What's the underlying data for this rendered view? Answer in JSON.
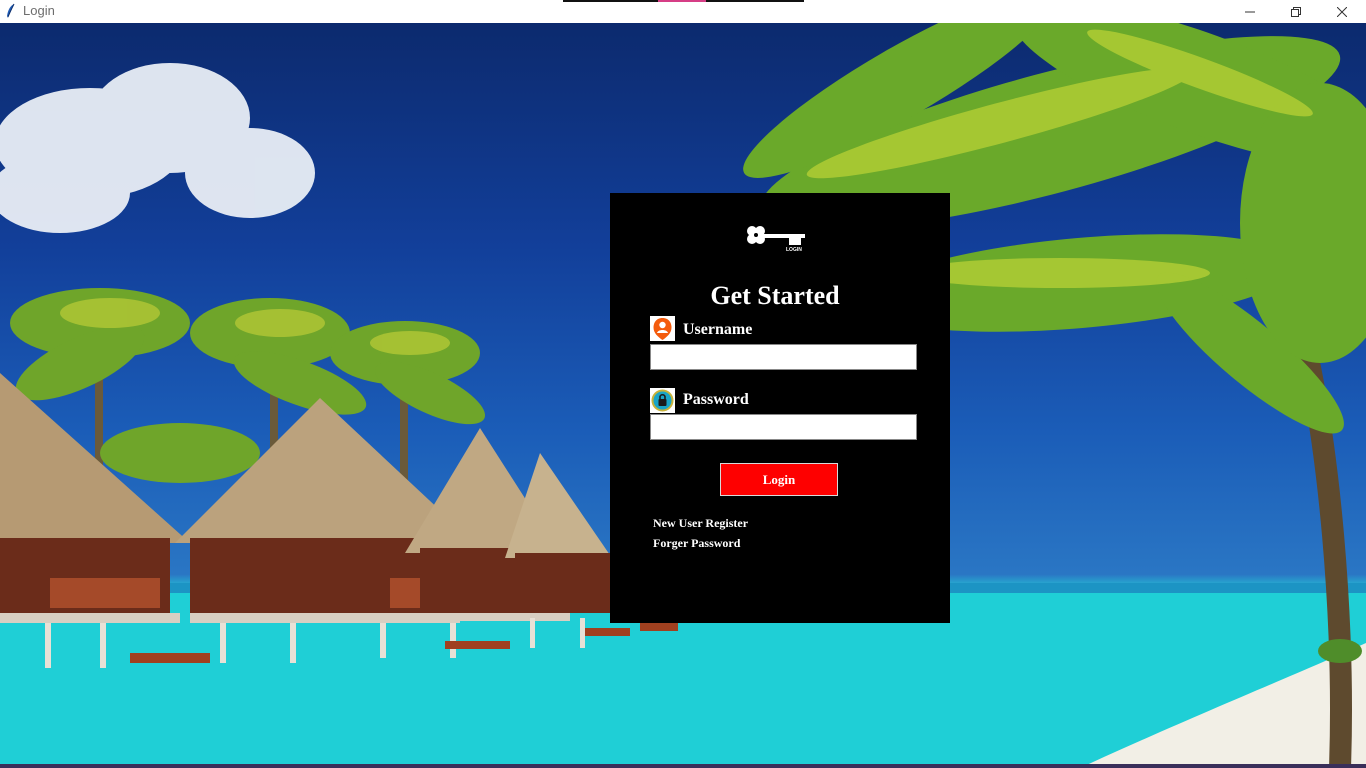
{
  "window": {
    "title": "Login",
    "controls": [
      "minimize-icon",
      "restore-icon",
      "close-icon"
    ]
  },
  "form": {
    "heading": "Get Started",
    "username_label": "Username",
    "username_value": "",
    "password_label": "Password",
    "password_value": "",
    "login_label": "Login",
    "register_link": "New User Register",
    "forgot_link": "Forger Password",
    "key_icon_caption": "LOGIN"
  },
  "colors": {
    "panel": "#000000",
    "button": "#fe0000",
    "user_icon": "#f45b0c",
    "lock_icon": "#1aa5c7"
  }
}
